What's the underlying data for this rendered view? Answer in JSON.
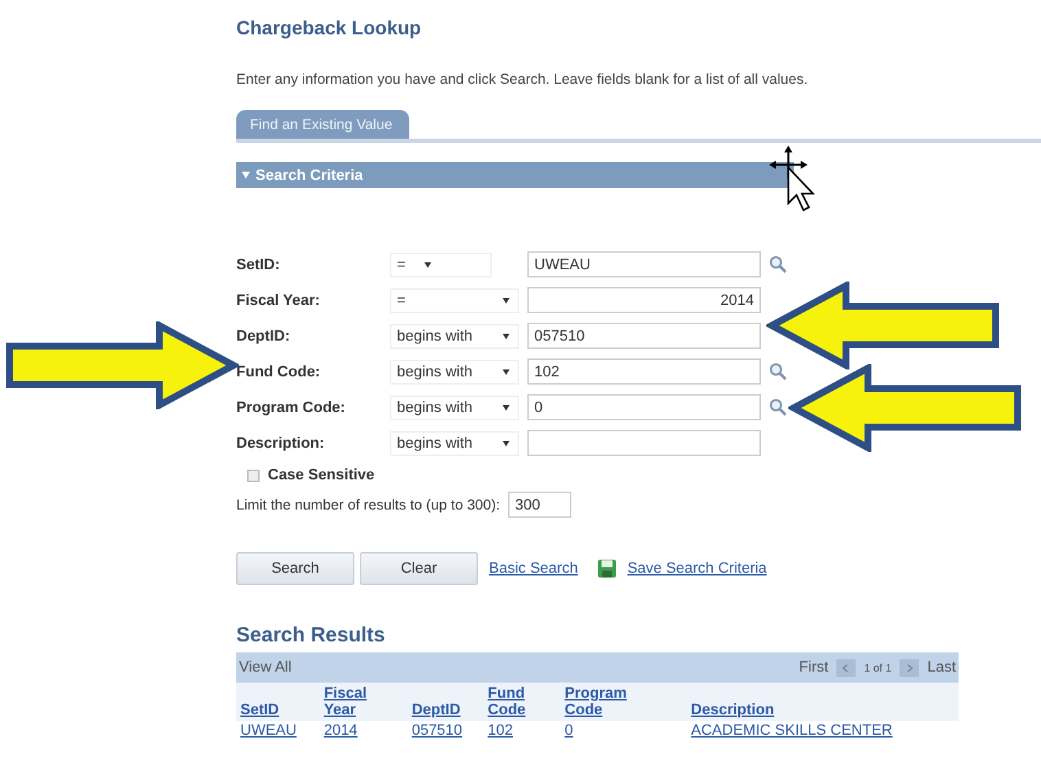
{
  "page": {
    "title": "Chargeback Lookup",
    "instructions": "Enter any information you have and click Search. Leave fields blank for a list of all values."
  },
  "tabs": [
    {
      "label": "Find an Existing Value",
      "selected": true
    }
  ],
  "criteria": {
    "title": "Search Criteria",
    "expanded": true,
    "fields": [
      {
        "label": "SetID:",
        "operator": "=",
        "value": "UWEAU",
        "lookup": true,
        "right_aligned": false
      },
      {
        "label": "Fiscal Year:",
        "operator": "=",
        "value": "2014",
        "lookup": false,
        "right_aligned": true
      },
      {
        "label": "DeptID:",
        "operator": "begins with",
        "value": "057510",
        "lookup": false,
        "right_aligned": false
      },
      {
        "label": "Fund Code:",
        "operator": "begins with",
        "value": "102",
        "lookup": true,
        "right_aligned": false
      },
      {
        "label": "Program Code:",
        "operator": "begins with",
        "value": "0",
        "lookup": true,
        "right_aligned": false
      },
      {
        "label": "Description:",
        "operator": "begins with",
        "lookup": false
      }
    ],
    "case_sensitive": {
      "label": "Case Sensitive",
      "checked": false
    },
    "limit": {
      "label": "Limit the number of results to (up to 300):",
      "value": "300"
    }
  },
  "actions": {
    "buttons": [
      "Search",
      "Clear"
    ],
    "links": [
      {
        "label": "Basic Search",
        "icon": false
      },
      {
        "label": "Save Search Criteria",
        "icon": true
      }
    ]
  },
  "results": {
    "title": "Search Results",
    "view_all": "View All",
    "pager": {
      "first": "First",
      "range": "1 of 1",
      "last": "Last"
    },
    "columns": [
      "SetID",
      "Fiscal Year",
      "DeptID",
      "Fund Code",
      "Program Code",
      "Description"
    ],
    "rows": [
      [
        "UWEAU",
        "2014",
        "057510",
        "102",
        "0",
        "ACADEMIC SKILLS CENTER"
      ]
    ]
  },
  "annotations": [
    {
      "points_right": true
    },
    {
      "points_right": false
    },
    {
      "points_right": false
    }
  ]
}
